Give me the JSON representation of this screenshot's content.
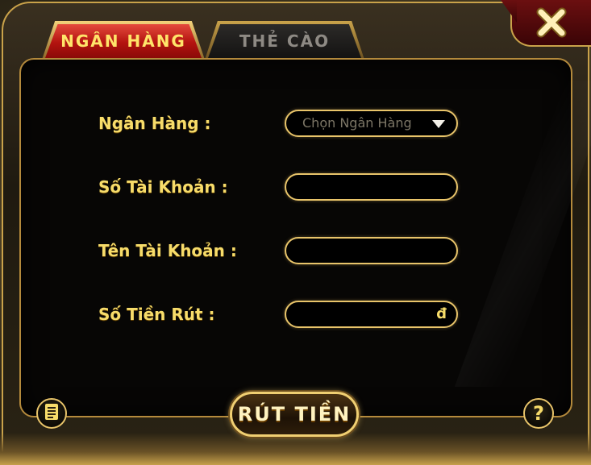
{
  "tabs": [
    {
      "label": "NGÂN HÀNG",
      "active": true
    },
    {
      "label": "THẺ CÀO",
      "active": false
    }
  ],
  "form": {
    "bank_label": "Ngân Hàng :",
    "bank_select_value": "Chọn Ngân Hàng",
    "account_number_label": "Số Tài Khoản :",
    "account_number_value": "",
    "account_name_label": "Tên Tài Khoản :",
    "account_name_value": "",
    "amount_label": "Số Tiền Rút :",
    "amount_value": "",
    "currency_symbol": "đ"
  },
  "actions": {
    "withdraw_label": "RÚT TIỀN",
    "help_label": "?"
  },
  "icons": {
    "close": "close-icon",
    "history": "document-list-icon",
    "dropdown": "caret-down-icon"
  },
  "colors": {
    "accent_gold": "#f7dc6a",
    "active_tab": "#b3130f",
    "frame_border": "#c9a24a"
  }
}
